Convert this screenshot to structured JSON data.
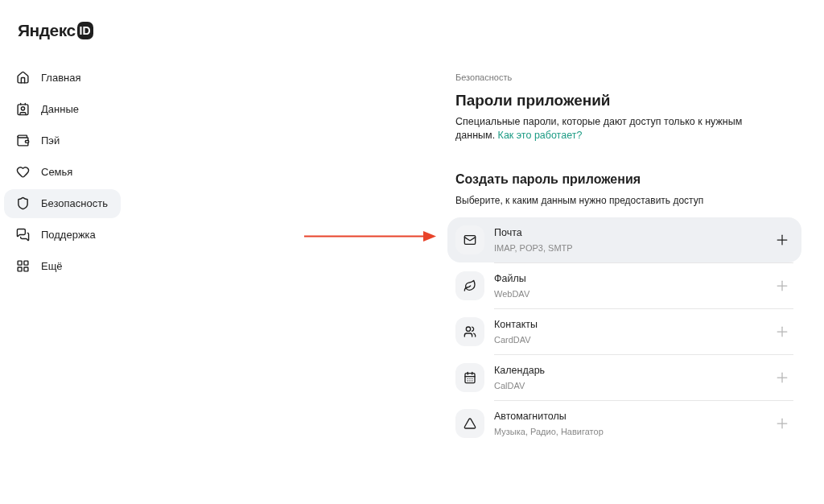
{
  "logo": {
    "wordmark": "Яндекс",
    "badge": "ID"
  },
  "sidebar": {
    "items": [
      {
        "label": "Главная",
        "selected": false
      },
      {
        "label": "Данные",
        "selected": false
      },
      {
        "label": "Пэй",
        "selected": false
      },
      {
        "label": "Семья",
        "selected": false
      },
      {
        "label": "Безопасность",
        "selected": true
      },
      {
        "label": "Поддержка",
        "selected": false
      },
      {
        "label": "Ещё",
        "selected": false
      }
    ]
  },
  "breadcrumb": "Безопасность",
  "title": "Пароли приложений",
  "description": "Специальные пароли, которые дают доступ только к нужным данным.",
  "help_link": "Как это работает?",
  "section": {
    "title": "Создать пароль приложения",
    "subtitle": "Выберите, к каким данным нужно предоставить доступ"
  },
  "apps": [
    {
      "name": "Почта",
      "protocols": "IMAP, POP3, SMTP",
      "highlighted": true
    },
    {
      "name": "Файлы",
      "protocols": "WebDAV",
      "highlighted": false
    },
    {
      "name": "Контакты",
      "protocols": "CardDAV",
      "highlighted": false
    },
    {
      "name": "Календарь",
      "protocols": "CalDAV",
      "highlighted": false
    },
    {
      "name": "Автомагнитолы",
      "protocols": "Музыка, Радио, Навигатор",
      "highlighted": false
    }
  ]
}
